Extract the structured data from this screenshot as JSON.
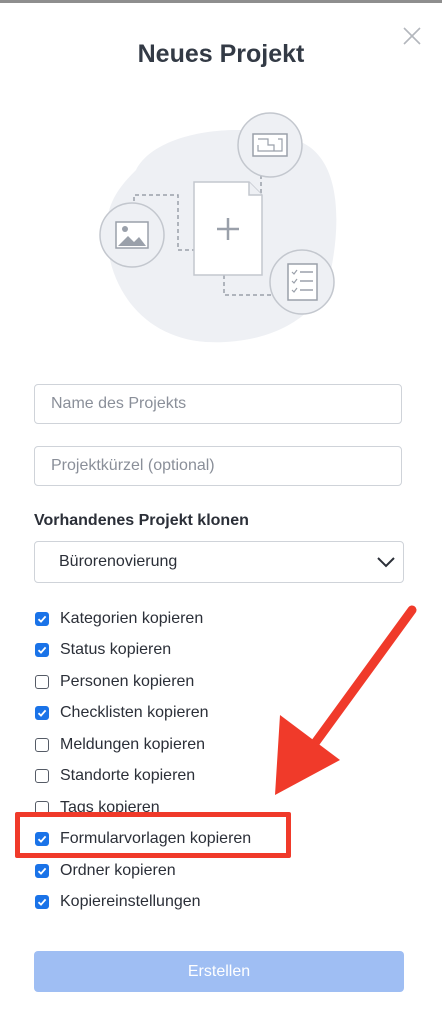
{
  "dialog": {
    "title": "Neues Projekt",
    "close_icon": "close-icon"
  },
  "form": {
    "name_placeholder": "Name des Projekts",
    "name_value": "",
    "short_placeholder": "Projektkürzel (optional)",
    "short_value": "",
    "clone_label": "Vorhandenes Projekt klonen",
    "clone_selected": "Bürorenovierung",
    "options": [
      {
        "label": "Kategorien kopieren",
        "checked": true
      },
      {
        "label": "Status kopieren",
        "checked": true
      },
      {
        "label": "Personen kopieren",
        "checked": false
      },
      {
        "label": "Checklisten kopieren",
        "checked": true
      },
      {
        "label": "Meldungen kopieren",
        "checked": false
      },
      {
        "label": "Standorte kopieren",
        "checked": false
      },
      {
        "label": "Tags kopieren",
        "checked": false
      },
      {
        "label": "Formularvorlagen kopieren",
        "checked": true
      },
      {
        "label": "Ordner kopieren",
        "checked": true
      },
      {
        "label": "Kopiereinstellungen",
        "checked": true
      }
    ],
    "submit_label": "Erstellen"
  },
  "colors": {
    "accent": "#1a73e8",
    "submit_disabled": "#9fbef3",
    "annotation": "#f03a2a"
  }
}
